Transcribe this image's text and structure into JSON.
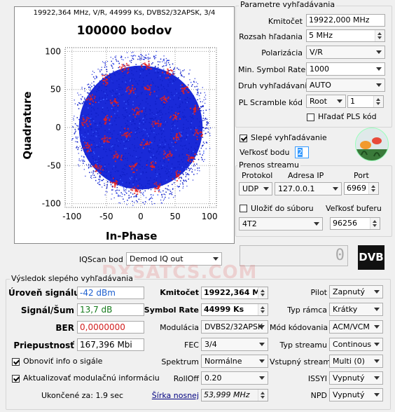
{
  "plot": {
    "header": "19922,364 MHz, V/R, 44999 Ks, DVBS2/32APSK, 3/4",
    "title": "100000 bodov",
    "xlabel": "In-Phase",
    "ylabel": "Quadrature"
  },
  "chart_data": {
    "type": "scatter",
    "title": "100000 bodov",
    "xlabel": "In-Phase",
    "ylabel": "Quadrature",
    "xlim": [
      -110,
      110
    ],
    "ylim": [
      -105,
      105
    ],
    "x_ticks": [
      "-100",
      "-50",
      "0",
      "50",
      "100"
    ],
    "y_ticks": [
      "100",
      "50",
      "0",
      "-50",
      "-100"
    ],
    "grid": true,
    "points_shown": 100000,
    "colors": {
      "points": "#1a2ad8",
      "dense": "#e8201c"
    }
  },
  "params": {
    "group_title": "Parametre vyhľadávania",
    "freq_label": "Kmitočet",
    "freq_value": "19922,000 MHz",
    "range_label": "Rozsah hľadania",
    "range_value": "5 MHz",
    "pol_label": "Polarizácia",
    "pol_value": "V/R",
    "minsr_label": "Min. Symbol Rate",
    "minsr_value": "1000",
    "type_label": "Druh vyhľadávania",
    "type_value": "AUTO",
    "pls_label": "PL Scramble kód",
    "pls_mode": "Root",
    "pls_value": "1",
    "pls_search_label": "Hľadať PLS kód"
  },
  "blind": {
    "slow_label": "Slepé vyhľadávanie",
    "step_label": "Veľkosť bodu",
    "step_value": "2"
  },
  "stream": {
    "group_title": "Prenos streamu",
    "proto_label": "Protokol",
    "ip_label": "Adresa IP",
    "port_label": "Port",
    "proto_value": "UDP",
    "ip_value": "127.0.0.1",
    "port_value": "6969",
    "save_label": "Uložiť do súboru",
    "buffer_label": "Veľkosť buferu",
    "file_value": "4T2",
    "buffer_value": "96256"
  },
  "iqscan": {
    "label": "IQScan bod",
    "value": "Demod IQ out",
    "counter": "0",
    "logo": "DVB"
  },
  "result": {
    "group_title": "Výsledok slepého vyhľadávania",
    "level_label": "Úroveň signálu",
    "level_value": "-42 dBm",
    "snr_label": "Signál/Šum",
    "snr_value": "13,7 dB",
    "ber_label": "BER",
    "ber_value": "0,0000000",
    "thr_label": "Priepustnosť",
    "thr_value": "167,396 Mbi",
    "refresh_label": "Obnoviť info o sigále",
    "update_label": "Aktualizovať modulačnú informáciu",
    "done_label": "Ukončené za: 1.9 sec",
    "freq_label": "Kmitočet",
    "freq_value": "19922,364 MH",
    "sr_label": "Symbol Rate",
    "sr_value": "44999 Ks",
    "mod_label": "Modulácia",
    "mod_value": "DVBS2/32APSK",
    "fec_label": "FEC",
    "fec_value": "3/4",
    "spec_label": "Spektrum",
    "spec_value": "Normálne",
    "roll_label": "RollOff",
    "roll_value": "0.20",
    "bw_label": "Šírka nosnej",
    "bw_value": "53,999 MHz",
    "pilot_label": "Pilot",
    "pilot_value": "Zapnutý",
    "frame_label": "Typ rámca",
    "frame_value": "Krátky",
    "modcod_label": "Mód kódovania",
    "modcod_value": "ACM/VCM",
    "stype_label": "Typ streamu",
    "stype_value": "Continous",
    "istream_label": "Vstupný stream",
    "istream_value": "Multi (0)",
    "issyi_label": "ISSYI",
    "issyi_value": "Vypnutý",
    "npd_label": "NPD",
    "npd_value": "Vypnutý"
  },
  "watermark": "DXSATCS.COM"
}
